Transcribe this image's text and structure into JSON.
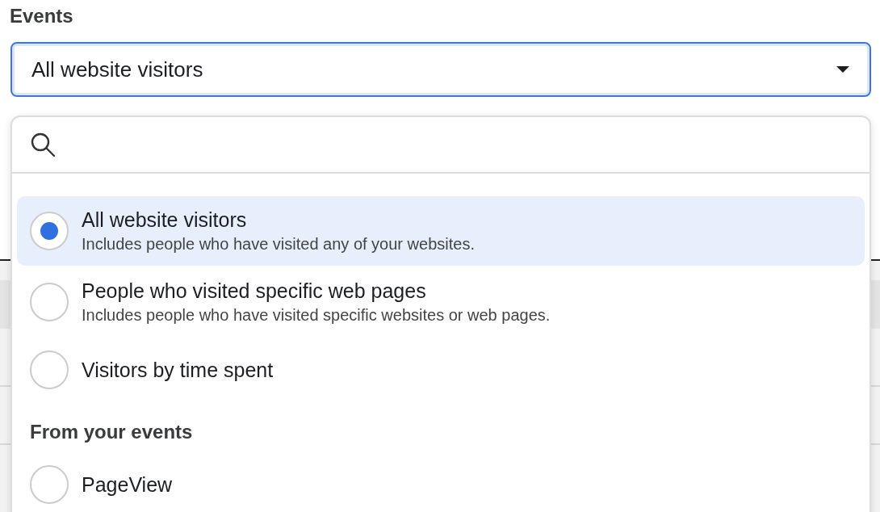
{
  "field": {
    "label": "Events",
    "value": "All website visitors",
    "expanded": true
  },
  "options": [
    {
      "kind": "option",
      "title": "All website visitors",
      "description": "Includes people who have visited any of your websites.",
      "selected": true
    },
    {
      "kind": "option",
      "title": "People who visited specific web pages",
      "description": "Includes people who have visited specific websites or web pages.",
      "selected": false
    },
    {
      "kind": "option",
      "title": "Visitors by time spent",
      "selected": false
    },
    {
      "kind": "header",
      "title": "From your events"
    },
    {
      "kind": "option",
      "title": "PageView",
      "selected": false
    }
  ]
}
